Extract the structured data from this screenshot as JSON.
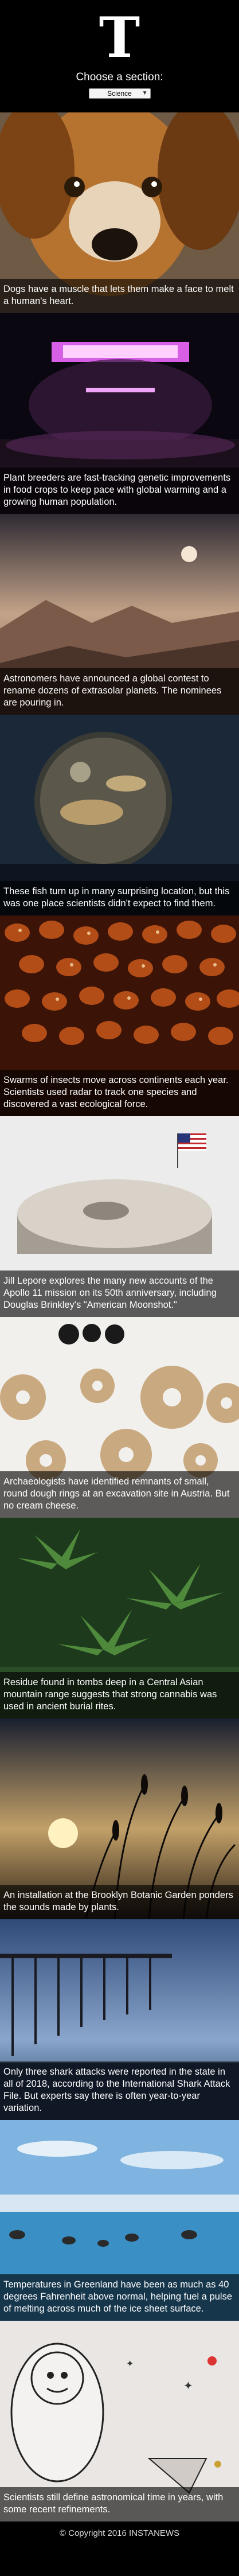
{
  "header": {
    "logo": "T",
    "choose_label": "Choose a section:",
    "selected_section": "Science"
  },
  "stories": [
    {
      "caption": "Dogs have a muscle that lets them make a face to melt a human's heart."
    },
    {
      "caption": "Plant breeders are fast-tracking genetic improvements in food crops to keep pace with global warming and a growing human population."
    },
    {
      "caption": "Astronomers have announced a global contest to rename dozens of extrasolar planets. The nominees are pouring in."
    },
    {
      "caption": "These fish turn up in many surprising location, but this was one place scientists didn't expect to find them."
    },
    {
      "caption": "Swarms of insects move across continents each year. Scientists used radar to track one species and discovered a vast ecological force."
    },
    {
      "caption": "Jill Lepore explores the many new accounts of the Apollo 11 mission on its 50th anniversary, including Douglas Brinkley's \"American Moonshot.\""
    },
    {
      "caption": "Archaeologists have identified remnants of small, round dough rings at an excavation site in Austria. But no cream cheese."
    },
    {
      "caption": "Residue found in tombs deep in a Central Asian mountain range suggests that strong cannabis was used in ancient burial rites."
    },
    {
      "caption": "An installation at the Brooklyn Botanic Garden ponders the sounds made by plants."
    },
    {
      "caption": "Only three shark attacks were reported in the state in all of 2018, according to the International Shark Attack File. But experts say there is often year-to-year variation."
    },
    {
      "caption": "Temperatures in Greenland have been as much as 40 degrees Fahrenheit above normal, helping fuel a pulse of melting across much of the ice sheet surface."
    },
    {
      "caption": "Scientists still define astronomical time in years, with some recent refinements."
    }
  ],
  "footer": {
    "text": "© Copyright 2016 INSTANEWS"
  }
}
